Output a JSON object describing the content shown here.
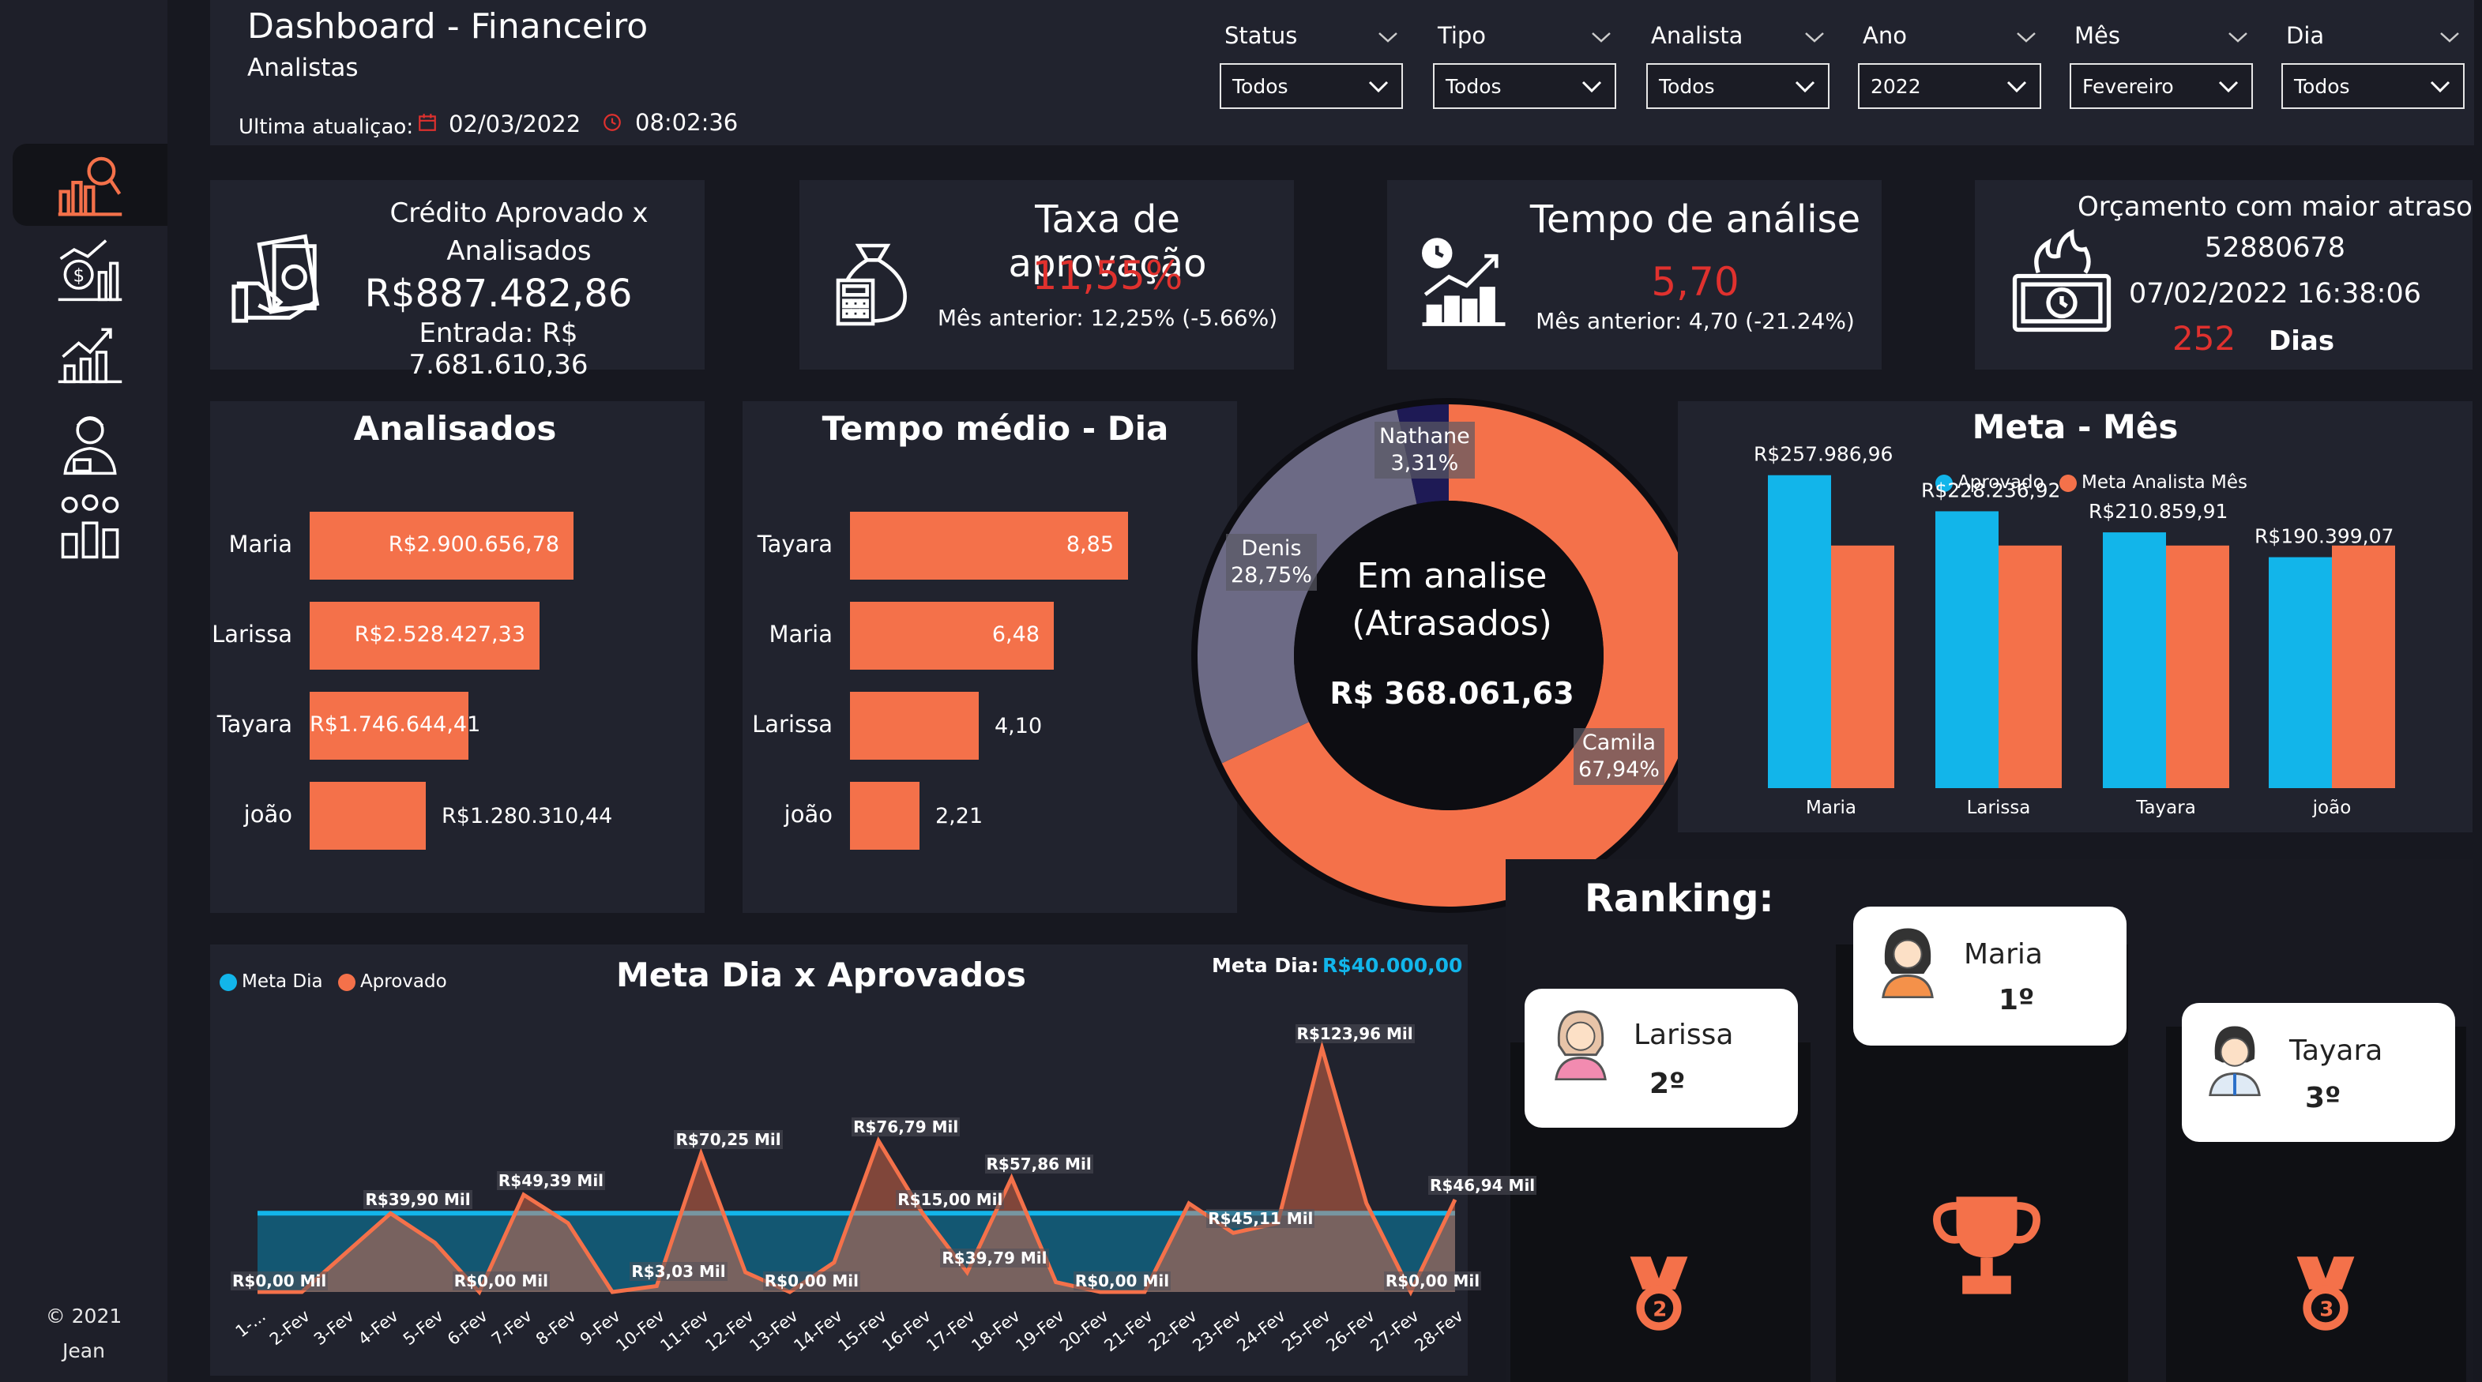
{
  "header": {
    "title": "Dashboard - Financeiro",
    "subtitle": "Analistas",
    "last_update_label": "Ultima atualiçao:",
    "last_update_date": "02/03/2022",
    "last_update_time": "08:02:36"
  },
  "filters": [
    {
      "label": "Status",
      "value": "Todos"
    },
    {
      "label": "Tipo",
      "value": "Todos"
    },
    {
      "label": "Analista",
      "value": "Todos"
    },
    {
      "label": "Ano",
      "value": "2022"
    },
    {
      "label": "Mês",
      "value": "Fevereiro"
    },
    {
      "label": "Dia",
      "value": "Todos"
    }
  ],
  "sidebar": {
    "icons": [
      "analytics-search-icon",
      "money-chart-icon",
      "growth-chart-icon",
      "analyst-user-icon",
      "team-chart-icon"
    ],
    "copyright": "© 2021",
    "author": "Jean"
  },
  "kpis": {
    "credito": {
      "title_line1": "Crédito Aprovado x",
      "title_line2": "Analisados",
      "value": "R$887.482,86",
      "entrada": "Entrada: R$ 7.681.610,36"
    },
    "taxa": {
      "title": "Taxa de aprovação",
      "value": "11,55%",
      "previous": "Mês anterior: 12,25% (-5.66%)"
    },
    "tempo": {
      "title": "Tempo de análise",
      "value": "5,70",
      "previous": "Mês anterior: 4,70 (-21.24%)"
    },
    "orcamento": {
      "title": "Orçamento com maior atraso",
      "id": "52880678",
      "datetime": "07/02/2022 16:38:06",
      "days_value": "252",
      "days_label": "Dias"
    }
  },
  "analisados": {
    "title": "Analisados",
    "items": [
      {
        "name": "Maria",
        "label": "R$2.900.656,78",
        "value": 2900656.78
      },
      {
        "name": "Larissa",
        "label": "R$2.528.427,33",
        "value": 2528427.33
      },
      {
        "name": "Tayara",
        "label": "R$1.746.644,41",
        "value": 1746644.41
      },
      {
        "name": "joão",
        "label": "R$1.280.310,44",
        "value": 1280310.44
      }
    ]
  },
  "tempo_medio": {
    "title": "Tempo médio - Dia",
    "items": [
      {
        "name": "Tayara",
        "label": "8,85",
        "value": 8.85
      },
      {
        "name": "Maria",
        "label": "6,48",
        "value": 6.48
      },
      {
        "name": "Larissa",
        "label": "4,10",
        "value": 4.1
      },
      {
        "name": "joão",
        "label": "2,21",
        "value": 2.21
      }
    ]
  },
  "donut": {
    "center_line1": "Em analise",
    "center_line2": "(Atrasados)",
    "center_value": "R$ 368.061,63",
    "slices": [
      {
        "name": "Camila",
        "label": "67,94%",
        "value": 67.94,
        "color": "#f4714a"
      },
      {
        "name": "Denis",
        "label": "28,75%",
        "value": 28.75,
        "color": "#6c6a85"
      },
      {
        "name": "Nathane",
        "label": "3,31%",
        "value": 3.31,
        "color": "#1e1a55"
      }
    ]
  },
  "meta_mes": {
    "title": "Meta - Mês",
    "legend": [
      {
        "name": "Aprovado",
        "color": "#12b5ea"
      },
      {
        "name": "Meta Analista Mês",
        "color": "#f4714a"
      }
    ],
    "categories": [
      "Maria",
      "Larissa",
      "Tayara",
      "joão"
    ],
    "aprovado": [
      257986.96,
      228236.92,
      210859.91,
      190399.07
    ],
    "aprovado_labels": [
      "R$257.986,96",
      "R$228.236,92",
      "R$210.859,91",
      "R$190.399,07"
    ],
    "meta": [
      200000,
      200000,
      200000,
      200000
    ]
  },
  "ranking": {
    "title": "Ranking:",
    "first": {
      "name": "Maria",
      "pos": "1º"
    },
    "second": {
      "name": "Larissa",
      "pos": "2º"
    },
    "third": {
      "name": "Tayara",
      "pos": "3º"
    }
  },
  "chart_data": {
    "type": "area",
    "title": "Meta Dia x Aprovados",
    "meta_label": "Meta Dia:",
    "meta_value": "R$40.000,00",
    "legend": [
      {
        "name": "Meta Dia",
        "color": "#12b5ea"
      },
      {
        "name": "Aprovado",
        "color": "#f4714a"
      }
    ],
    "x": [
      "1-...",
      "2-Fev",
      "3-Fev",
      "4-Fev",
      "5-Fev",
      "6-Fev",
      "7-Fev",
      "8-Fev",
      "9-Fev",
      "10-Fev",
      "11-Fev",
      "12-Fev",
      "13-Fev",
      "14-Fev",
      "15-Fev",
      "16-Fev",
      "17-Fev",
      "18-Fev",
      "19-Fev",
      "20-Fev",
      "21-Fev",
      "22-Fev",
      "23-Fev",
      "24-Fev",
      "25-Fev",
      "26-Fev",
      "27-Fev",
      "28-Fev"
    ],
    "series": [
      {
        "name": "Meta Dia",
        "values": [
          40,
          40,
          40,
          40,
          40,
          40,
          40,
          40,
          40,
          40,
          40,
          40,
          40,
          40,
          40,
          40,
          40,
          40,
          40,
          40,
          40,
          40,
          40,
          40,
          40,
          40,
          40,
          40
        ]
      },
      {
        "name": "Aprovado",
        "values": [
          0,
          0,
          20,
          39.9,
          25,
          0,
          49.39,
          35,
          0,
          3.03,
          70.25,
          10,
          0,
          15,
          76.79,
          39.79,
          10,
          57.86,
          5,
          0,
          0,
          45,
          30,
          35,
          123.96,
          45.11,
          0,
          46.94
        ]
      }
    ],
    "point_labels": [
      {
        "index": 0,
        "label": "R$0,00 Mil"
      },
      {
        "index": 3,
        "label": "R$39,90 Mil"
      },
      {
        "index": 5,
        "label": "R$0,00 Mil"
      },
      {
        "index": 6,
        "label": "R$49,39 Mil"
      },
      {
        "index": 9,
        "label": "R$3,03 Mil"
      },
      {
        "index": 10,
        "label": "R$70,25 Mil"
      },
      {
        "index": 12,
        "label": "R$0,00 Mil"
      },
      {
        "index": 14,
        "label": "R$76,79 Mil"
      },
      {
        "index": 15,
        "label": "R$15,00 Mil"
      },
      {
        "index": 16,
        "label": "R$39,79 Mil"
      },
      {
        "index": 17,
        "label": "R$57,86 Mil"
      },
      {
        "index": 19,
        "label": "R$0,00 Mil"
      },
      {
        "index": 22,
        "label": "R$45,11 Mil"
      },
      {
        "index": 24,
        "label": "R$123,96 Mil"
      },
      {
        "index": 26,
        "label": "R$0,00 Mil"
      },
      {
        "index": 27,
        "label": "R$46,94 Mil"
      }
    ],
    "ylim": [
      0,
      130
    ]
  }
}
